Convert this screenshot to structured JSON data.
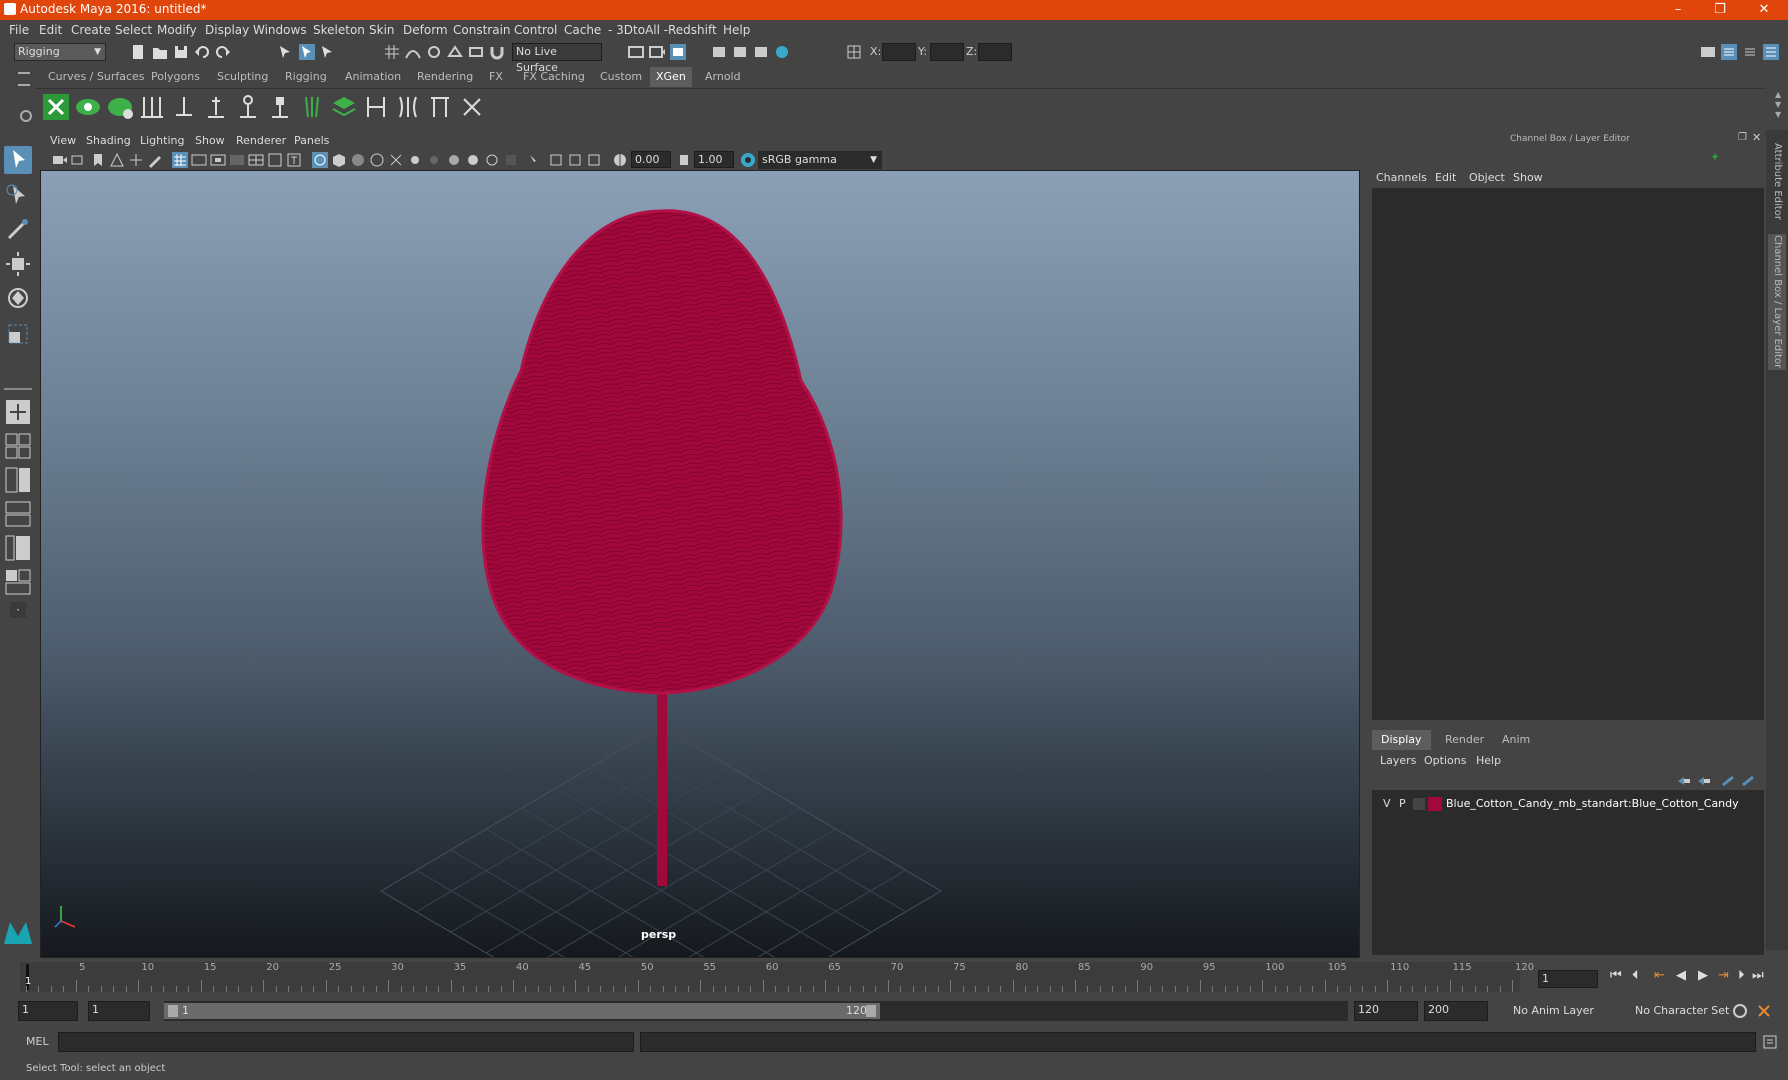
{
  "window": {
    "title": "Autodesk Maya 2016: untitled*",
    "controls": [
      "–",
      "❐",
      "✕"
    ]
  },
  "menubar": [
    "File",
    "Edit",
    "Create",
    "Select",
    "Modify",
    "Display",
    "Windows",
    "Skeleton",
    "Skin",
    "Deform",
    "Constrain",
    "Control",
    "Cache",
    "- 3DtoAll -",
    "Redshift",
    "Help"
  ],
  "statusline": {
    "mode_menu": "Rigging",
    "live_surface": "No Live Surface",
    "x_label": "X:",
    "y_label": "Y:",
    "z_label": "Z:"
  },
  "shelf": {
    "tabs": [
      "Curves / Surfaces",
      "Polygons",
      "Sculpting",
      "Rigging",
      "Animation",
      "Rendering",
      "FX",
      "FX Caching",
      "Custom",
      "XGen",
      "Arnold"
    ],
    "active_tab": "XGen"
  },
  "viewport": {
    "menu": [
      "View",
      "Shading",
      "Lighting",
      "Show",
      "Renderer",
      "Panels"
    ],
    "exposure": "0.00",
    "gamma": "1.00",
    "color_space": "sRGB gamma",
    "camera_label": "persp",
    "object_color": "#a0093a"
  },
  "channelbox": {
    "title": "Channel Box / Layer Editor",
    "menu": [
      "Channels",
      "Edit",
      "Object",
      "Show"
    ],
    "side_tabs": [
      "Attribute Editor",
      "Channel Box / Layer Editor"
    ]
  },
  "layers": {
    "tabs": [
      "Display",
      "Render",
      "Anim"
    ],
    "active_tab": "Display",
    "menu": [
      "Layers",
      "Options",
      "Help"
    ],
    "items": [
      {
        "v": "V",
        "p": "P",
        "name": "Blue_Cotton_Candy_mb_standart:Blue_Cotton_Candy",
        "color": "#a0093a"
      }
    ]
  },
  "timeline": {
    "ticks": [
      "1",
      "5",
      "10",
      "15",
      "20",
      "25",
      "30",
      "35",
      "40",
      "45",
      "50",
      "55",
      "60",
      "65",
      "70",
      "75",
      "80",
      "85",
      "90",
      "95",
      "100",
      "105",
      "110",
      "115",
      "120"
    ],
    "current_frame": "1"
  },
  "range": {
    "start": "1",
    "playback_start": "1",
    "slider_start": "1",
    "slider_end": "120",
    "playback_end": "120",
    "end": "200",
    "anim_layer": "No Anim Layer",
    "character_set": "No Character Set"
  },
  "command": {
    "label": "MEL"
  },
  "helpline": "Select Tool: select an object"
}
